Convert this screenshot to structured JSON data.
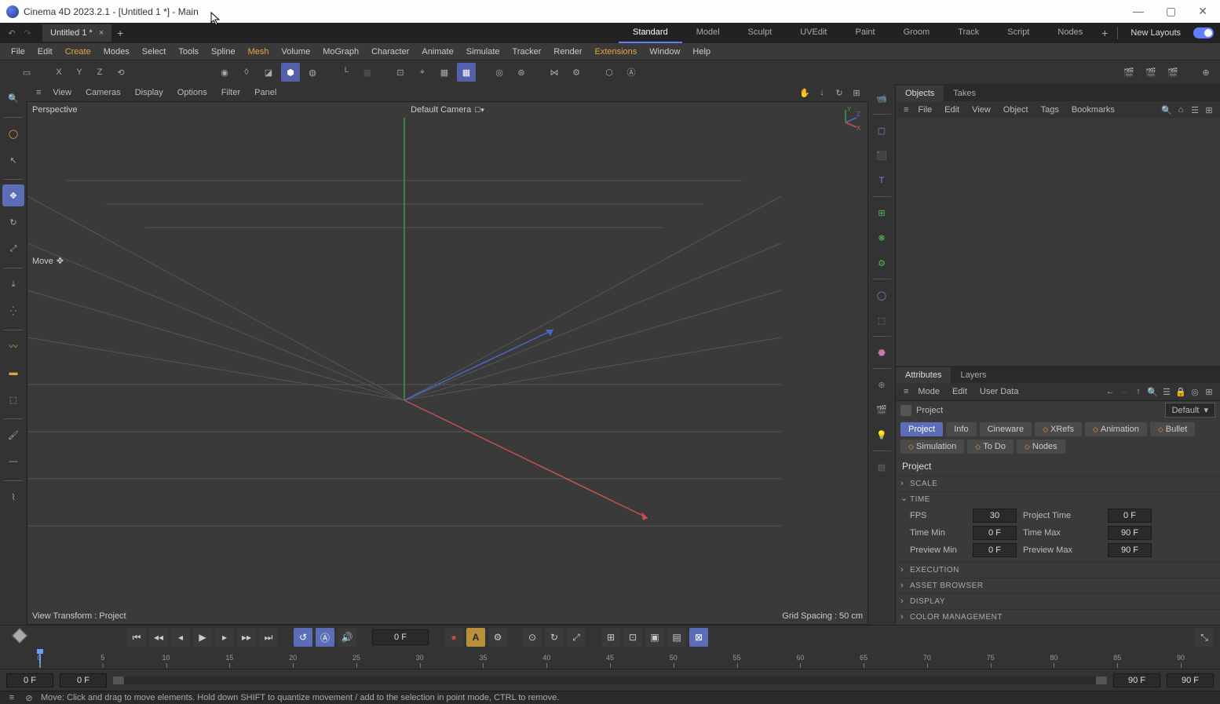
{
  "titlebar": {
    "text": "Cinema 4D 2023.2.1 - [Untitled 1 *] - Main"
  },
  "doc_tab": {
    "name": "Untitled 1 *"
  },
  "layouts": {
    "items": [
      "Standard",
      "Model",
      "Sculpt",
      "UVEdit",
      "Paint",
      "Groom",
      "Track",
      "Script",
      "Nodes"
    ],
    "active": "Standard",
    "new_layouts": "New Layouts"
  },
  "menu": {
    "items": [
      "File",
      "Edit",
      "Create",
      "Modes",
      "Select",
      "Tools",
      "Spline",
      "Mesh",
      "Volume",
      "MoGraph",
      "Character",
      "Animate",
      "Simulate",
      "Tracker",
      "Render",
      "Extensions",
      "Window",
      "Help"
    ],
    "highlight": [
      "Create",
      "Mesh",
      "Extensions"
    ]
  },
  "axes": [
    "X",
    "Y",
    "Z"
  ],
  "viewport_menu": [
    "View",
    "Cameras",
    "Display",
    "Options",
    "Filter",
    "Panel"
  ],
  "viewport": {
    "label_tl": "Perspective",
    "label_tc": "Default Camera",
    "label_ml": "Move",
    "label_bl": "View Transform : Project",
    "label_br": "Grid Spacing : 50 cm"
  },
  "objects_panel": {
    "tabs": [
      "Objects",
      "Takes"
    ],
    "menu": [
      "File",
      "Edit",
      "View",
      "Object",
      "Tags",
      "Bookmarks"
    ]
  },
  "attr_panel": {
    "tabs": [
      "Attributes",
      "Layers"
    ],
    "menu": [
      "Mode",
      "Edit",
      "User Data"
    ],
    "header": "Project",
    "default": "Default",
    "subtabs": [
      "Project",
      "Info",
      "Cineware",
      "XRefs",
      "Animation",
      "Bullet",
      "Simulation",
      "To Do",
      "Nodes"
    ],
    "active_subtab": "Project",
    "section_title": "Project",
    "groups": {
      "scale": "SCALE",
      "time": "TIME",
      "execution": "EXECUTION",
      "asset_browser": "ASSET BROWSER",
      "display": "DISPLAY",
      "color_mgmt": "COLOR MANAGEMENT"
    },
    "time": {
      "fps_label": "FPS",
      "fps": "30",
      "proj_time_label": "Project Time",
      "proj_time": "0 F",
      "tmin_label": "Time Min",
      "tmin": "0 F",
      "tmax_label": "Time Max",
      "tmax": "90 F",
      "pmin_label": "Preview Min",
      "pmin": "0 F",
      "pmax_label": "Preview Max",
      "pmax": "90 F"
    }
  },
  "timeline": {
    "frame": "0 F",
    "ticks": [
      "0",
      "5",
      "10",
      "15",
      "20",
      "25",
      "30",
      "35",
      "40",
      "45",
      "50",
      "55",
      "60",
      "65",
      "70",
      "75",
      "80",
      "85",
      "90"
    ]
  },
  "range": {
    "start": "0 F",
    "startB": "0 F",
    "endA": "90 F",
    "endB": "90 F"
  },
  "status": {
    "text": "Move: Click and drag to move elements. Hold down SHIFT to quantize movement / add to the selection in point mode, CTRL to remove."
  }
}
